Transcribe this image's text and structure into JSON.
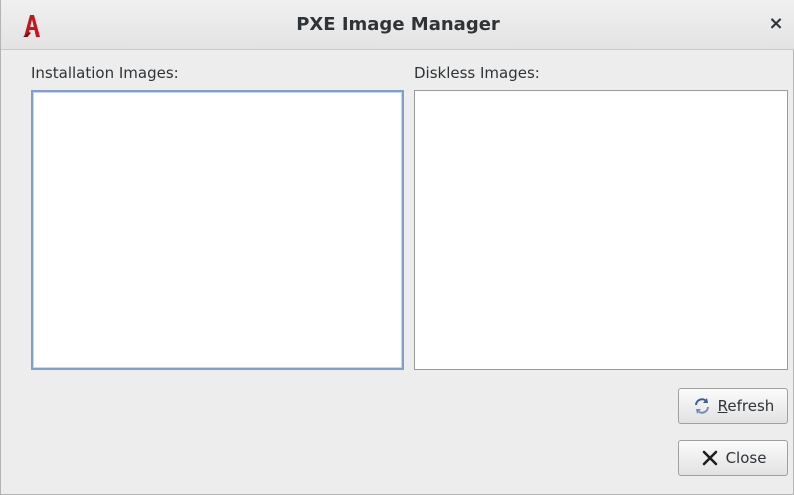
{
  "window": {
    "title": "PXE Image Manager",
    "close_glyph": "×",
    "app_icon": "app-logo-icon"
  },
  "panels": {
    "installation": {
      "label": "Installation Images:",
      "items": []
    },
    "diskless": {
      "label": "Diskless Images:",
      "items": []
    }
  },
  "buttons": {
    "refresh": {
      "mnemonic": "R",
      "label_rest": "efresh",
      "icon": "refresh-icon"
    },
    "close": {
      "label": "Close",
      "icon": "close-icon"
    }
  },
  "colors": {
    "window_bg": "#ededed",
    "focus_border": "#7f9fcc",
    "text": "#2e3436",
    "icon_red": "#c4161c"
  }
}
